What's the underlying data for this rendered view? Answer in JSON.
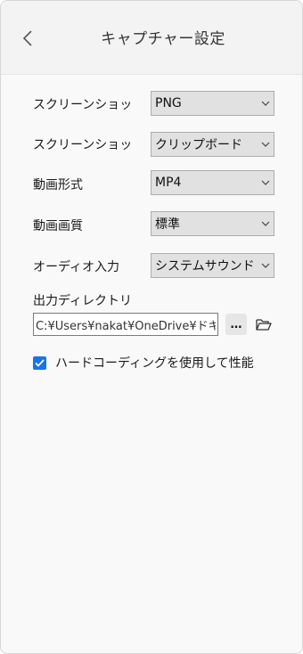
{
  "header": {
    "title": "キャプチャー設定"
  },
  "settings": [
    {
      "label": "スクリーンショッ",
      "value": "PNG"
    },
    {
      "label": "スクリーンショッ",
      "value": "クリップボード"
    },
    {
      "label": "動画形式",
      "value": "MP4"
    },
    {
      "label": "動画画質",
      "value": "標準"
    },
    {
      "label": "オーディオ入力",
      "value": "システムサウンド"
    }
  ],
  "output_dir": {
    "label": "出力ディレクトリ",
    "value": "C:¥Users¥nakat¥OneDrive¥ドキュメント",
    "browse_label": "…"
  },
  "hardware": {
    "label": "ハードコーディングを使用して性能",
    "checked": true
  },
  "icons": {
    "back": "chevron-left-icon",
    "dropdown": "chevron-down-icon",
    "folder": "folder-open-icon",
    "check": "checkmark-icon"
  },
  "colors": {
    "accent": "#1a73e8",
    "select_bg": "#e1e1e1",
    "header_bg": "#f3f3f3"
  }
}
